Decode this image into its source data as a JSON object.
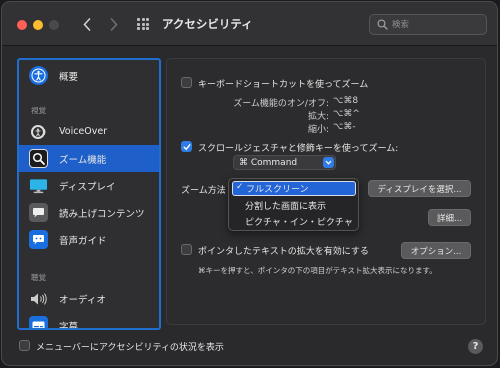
{
  "window": {
    "title": "アクセシビリティ"
  },
  "search": {
    "placeholder": "検索"
  },
  "sidebar": {
    "items": [
      {
        "label": "概要",
        "icon": "accessibility-icon"
      },
      {
        "label": "VoiceOver",
        "icon": "voiceover-icon"
      },
      {
        "label": "ズーム機能",
        "icon": "zoom-icon",
        "selected": true
      },
      {
        "label": "ディスプレイ",
        "icon": "display-icon"
      },
      {
        "label": "読み上げコンテンツ",
        "icon": "speech-bubble-icon"
      },
      {
        "label": "音声ガイド",
        "icon": "audio-description-icon"
      },
      {
        "label": "オーディオ",
        "icon": "speaker-icon"
      },
      {
        "label": "字幕",
        "icon": "captions-icon"
      }
    ],
    "sections": {
      "vision": "視覚",
      "hearing": "聴覚"
    }
  },
  "zoom": {
    "keyboard_shortcut": {
      "label": "キーボードショートカットを使ってズーム",
      "checked": false
    },
    "shortcuts": [
      {
        "label": "ズーム機能のオン/オフ:",
        "keys": "⌥⌘8"
      },
      {
        "label": "拡大:",
        "keys": "⌥⌘^"
      },
      {
        "label": "縮小:",
        "keys": "⌥⌘-"
      }
    ],
    "scroll_gesture": {
      "label": "スクロールジェスチャと修飾キーを使ってズーム:",
      "checked": true
    },
    "modifier_key": {
      "value": "⌘ Command"
    },
    "zoom_style": {
      "label": "ズーム方法",
      "options": [
        "フルスクリーン",
        "分割した画面に表示",
        "ピクチャ・イン・ピクチャ"
      ],
      "selected": "フルスクリーン"
    },
    "select_display_button": "ディスプレイを選択...",
    "details_button": "詳細...",
    "hover_text": {
      "label": "ポインタしたテキストの拡大を有効にする",
      "checked": false
    },
    "options_button": "オプション...",
    "hover_text_hint": "⌘キーを押すと、ポインタの下の項目がテキスト拡大表示になります。"
  },
  "footer": {
    "menubar_status": {
      "label": "メニューバーにアクセシビリティの状況を表示",
      "checked": false
    },
    "help": "?"
  },
  "colors": {
    "accent": "#1f5fc9",
    "sidebar_border": "#1f6fd0"
  }
}
